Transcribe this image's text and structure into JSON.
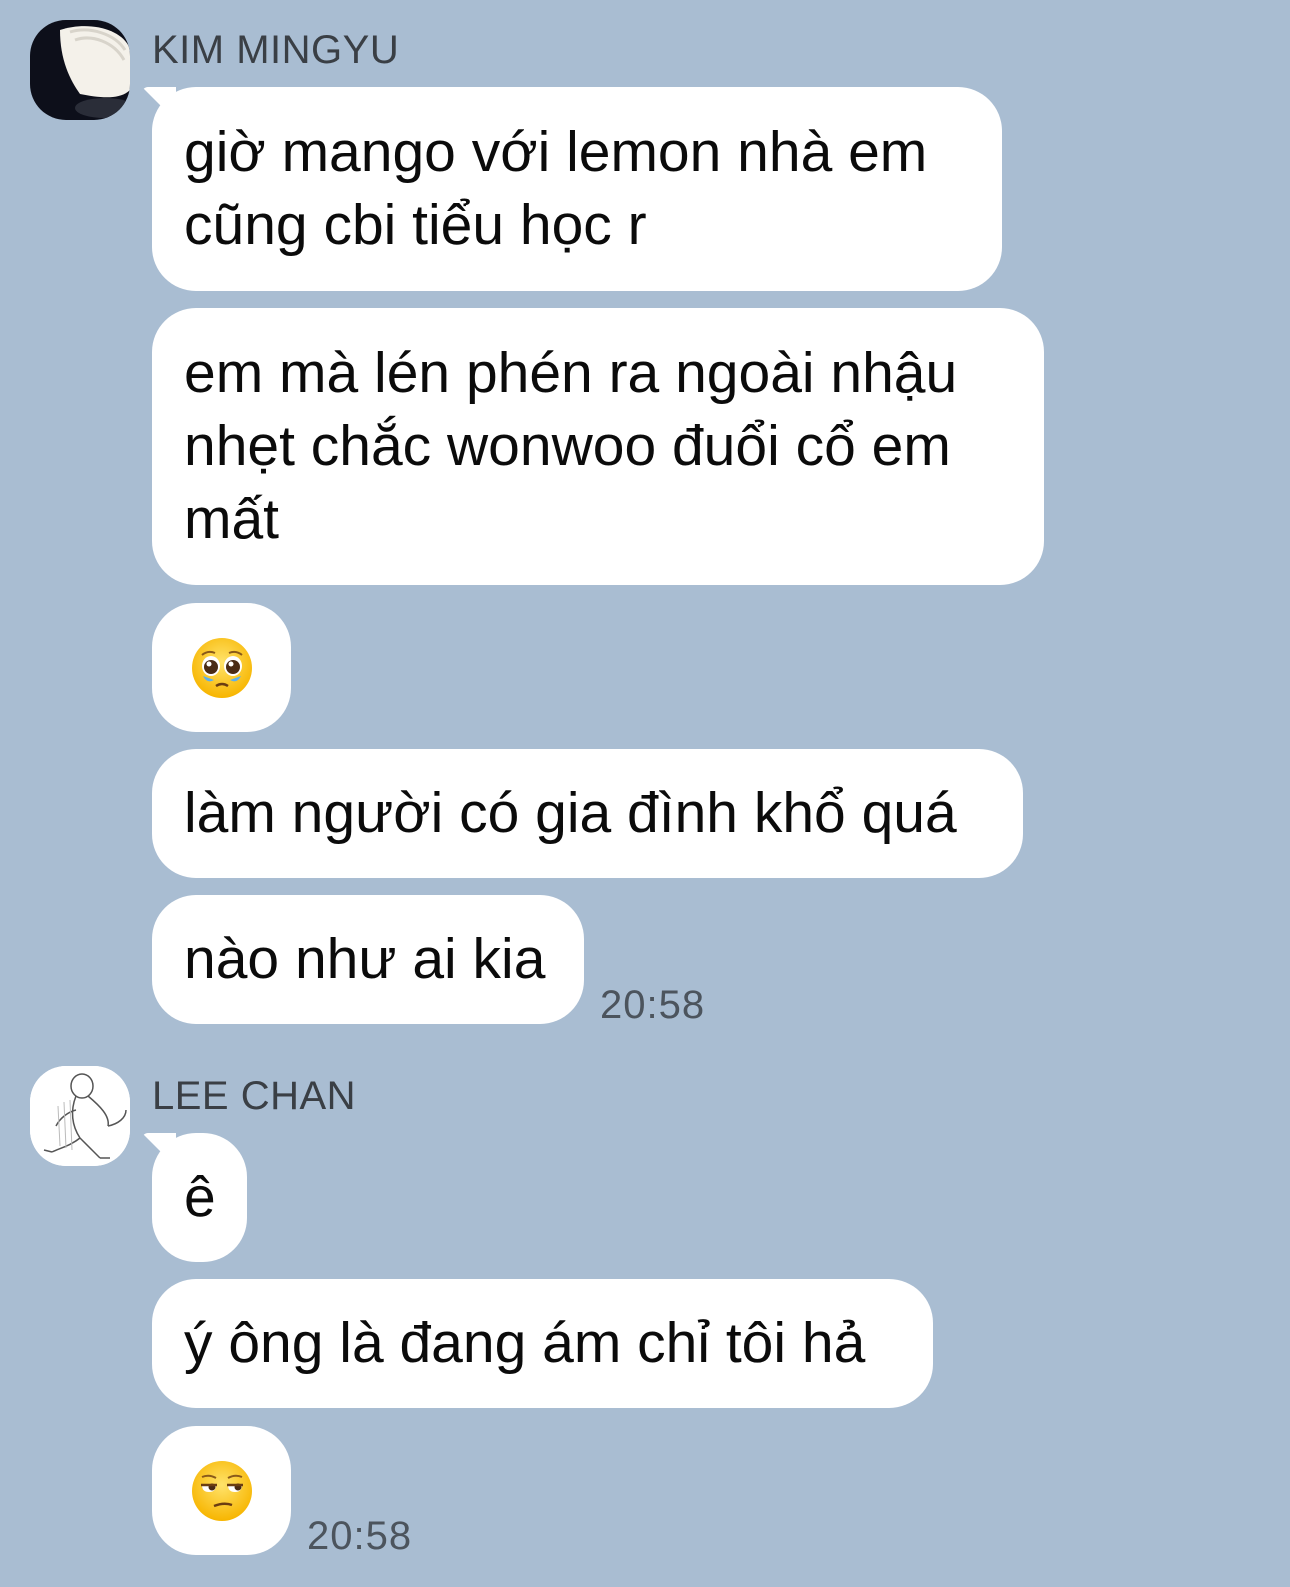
{
  "colors": {
    "background": "#a9bdd2",
    "bubble": "#ffffff",
    "name_text": "#3a3f45",
    "time_text": "#4c545d"
  },
  "groups": [
    {
      "sender": "KIM MINGYU",
      "avatar_icon": "dark-photo-avatar",
      "messages": [
        "giờ mango với lemon nhà em\ncũng cbi tiểu học r",
        "em mà lén phén ra ngoài nhậu\nnhẹt chắc wonwoo đuổi cổ em\nmất",
        {
          "emoji": "pleading-face-emoji"
        },
        "làm người có gia đình khổ quá",
        "nào như ai kia"
      ],
      "time": "20:58"
    },
    {
      "sender": "LEE CHAN",
      "avatar_icon": "sketch-drawing-avatar",
      "messages": [
        "ê",
        "ý ông là đang ám chỉ tôi hả",
        {
          "emoji": "unamused-face-emoji"
        }
      ],
      "time": "20:58"
    }
  ]
}
